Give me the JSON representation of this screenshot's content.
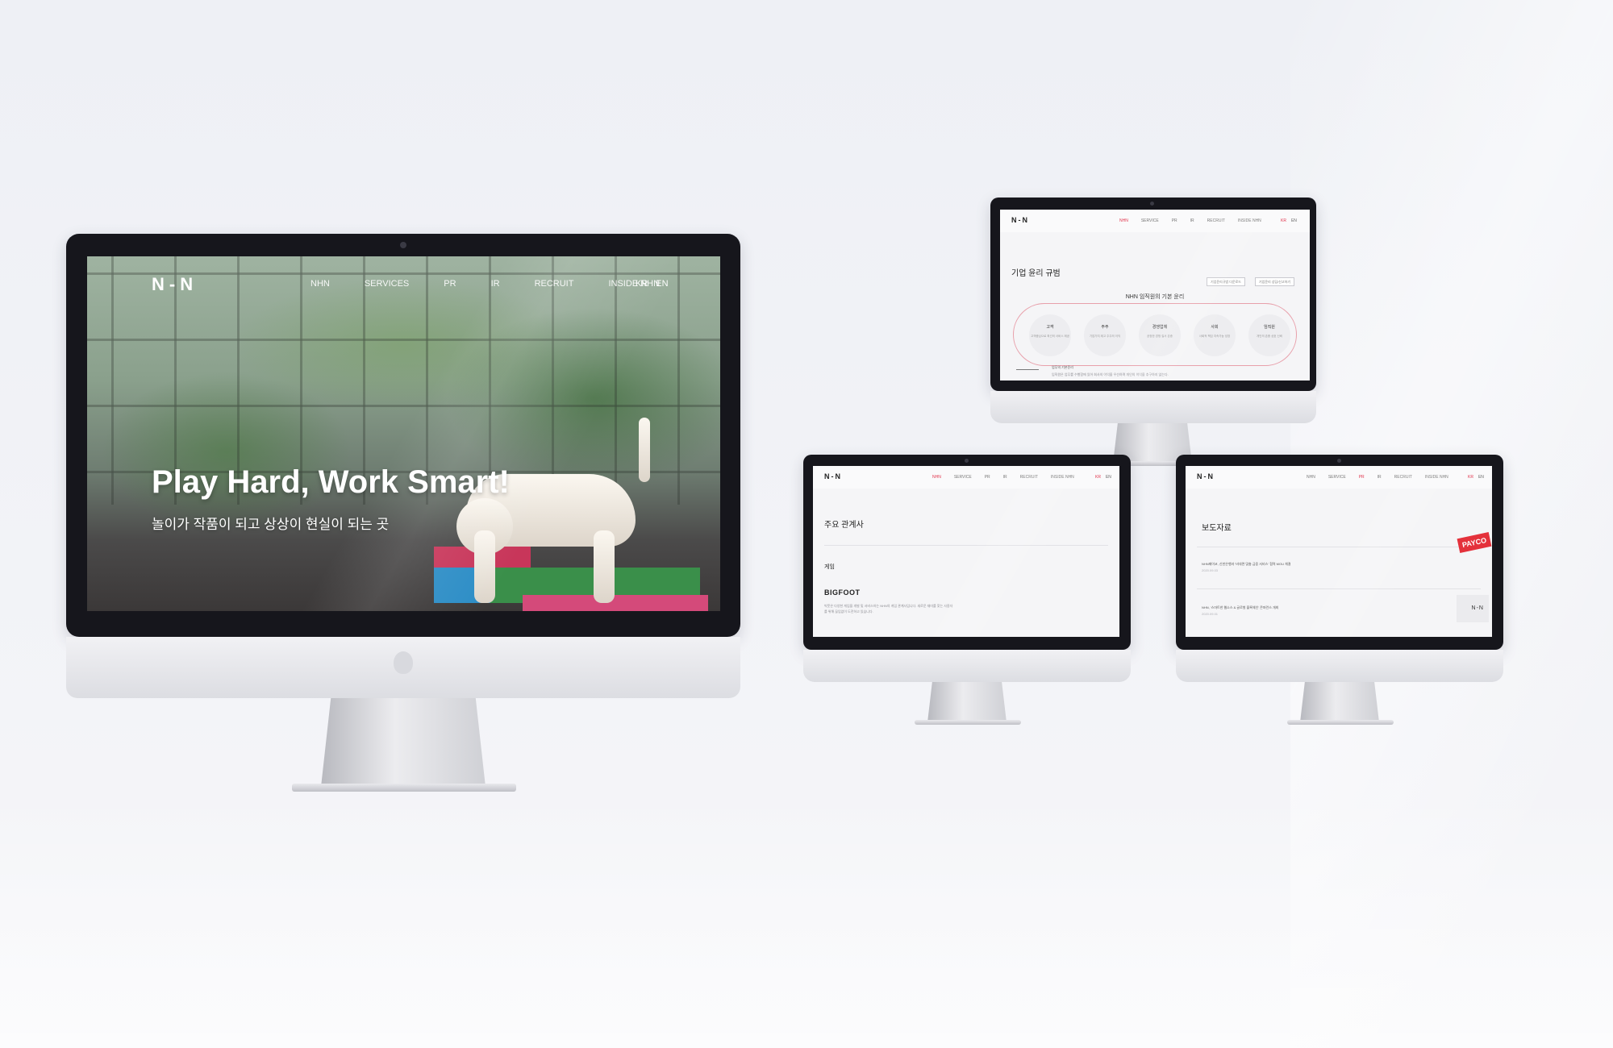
{
  "hero": {
    "logo": "N-N",
    "menu": [
      "NHN",
      "SERVICES",
      "PR",
      "IR",
      "RECRUIT",
      "INSIDE NHN"
    ],
    "lang": [
      "KR",
      "EN"
    ],
    "title": "Play Hard, Work Smart!",
    "subtitle": "놀이가 작품이 되고 상상이 현실이 되는 곳"
  },
  "ethics": {
    "logo": "N-N",
    "menu": [
      "NHN",
      "SERVICE",
      "PR",
      "IR",
      "RECRUIT",
      "INSIDE NHN"
    ],
    "lang": [
      "KR",
      "EN"
    ],
    "title": "기업 윤리 규범",
    "buttons": [
      "기업윤리규범 다운로드",
      "기업윤리 상담/신고하기"
    ],
    "heading": "NHN 임직원의 기본 윤리",
    "circles": [
      {
        "title": "고객",
        "desc": "고객중심으로 최선의 서비스 제공"
      },
      {
        "title": "주주",
        "desc": "기업가치 제고 주주의 이익"
      },
      {
        "title": "경쟁업체",
        "desc": "공정한 경쟁 질서 존중"
      },
      {
        "title": "사회",
        "desc": "사회적 책임 지속가능 성장"
      },
      {
        "title": "임직원",
        "desc": "개인의 존중 상호 신뢰"
      }
    ],
    "section": "업무의 기본윤리",
    "section_text": "임직원은 업무를 수행함에 있어 회사의 이익을 우선하며 개인의 이익을 추구하지 않는다."
  },
  "affiliates": {
    "logo": "N-N",
    "menu": [
      "NHN",
      "SERVICE",
      "PR",
      "IR",
      "RECRUIT",
      "INSIDE NHN"
    ],
    "lang": [
      "KR",
      "EN"
    ],
    "title": "주요 관계사",
    "category": "게임",
    "company": "BIGFOOT",
    "desc": "빅풋은 다양한 게임을 개발 및 서비스하는 NHN의 게임 관계사입니다. 새로운 재미를 찾는 사용자를 위해 끊임없이 도전하고 있습니다."
  },
  "press": {
    "logo": "N-N",
    "menu": [
      "NHN",
      "SERVICE",
      "PR",
      "IR",
      "RECRUIT",
      "INSIDE NHN"
    ],
    "lang": [
      "KR",
      "EN"
    ],
    "title": "보도자료",
    "items": [
      {
        "headline": "NHN페이코, 신한은행과 '비대면 맞춤 금융 서비스' 협력 MOU 체결",
        "date": "2020.09.03",
        "logo": "PAYCO"
      },
      {
        "headline": "NHN, '스마트한 웹소스 & 글로벌 블록체인' 콘퍼런스 개최",
        "date": "2020.09.01",
        "logo": "N-N"
      }
    ]
  }
}
